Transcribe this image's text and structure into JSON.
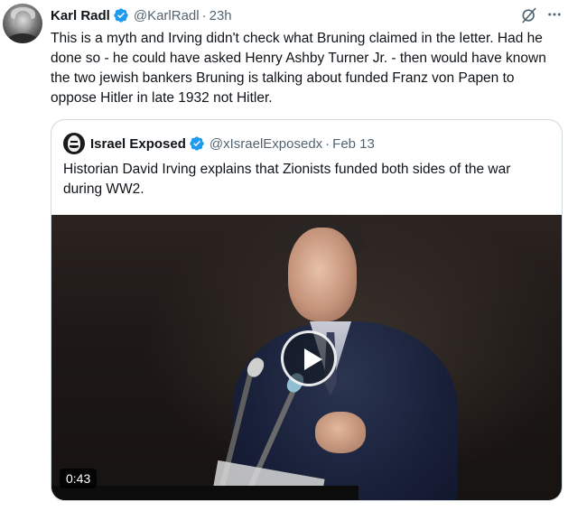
{
  "tweet": {
    "author_name": "Karl Radl",
    "handle": "@KarlRadl",
    "separator": "·",
    "time": "23h",
    "text": "This is a myth and Irving didn't check what Bruning claimed in the letter. Had he done so - he could have asked Henry Ashby Turner Jr. - then would have known the two jewish bankers Bruning is talking about funded Franz von Papen to oppose Hitler in late 1932 not Hitler.",
    "icons": [
      "grok-icon",
      "more-icon",
      "verified-badge-icon"
    ]
  },
  "quote": {
    "author_name": "Israel Exposed",
    "handle": "@xIsraelExposedx",
    "separator": "·",
    "time": "Feb 13",
    "text": "Historian David Irving explains that Zionists funded both sides of the war during WW2.",
    "video": {
      "duration": "0:43",
      "icon": "play-icon"
    }
  },
  "colors": {
    "text": "#0f1419",
    "secondary": "#536471",
    "verified": "#1d9bf0",
    "border": "#cfd9de"
  }
}
